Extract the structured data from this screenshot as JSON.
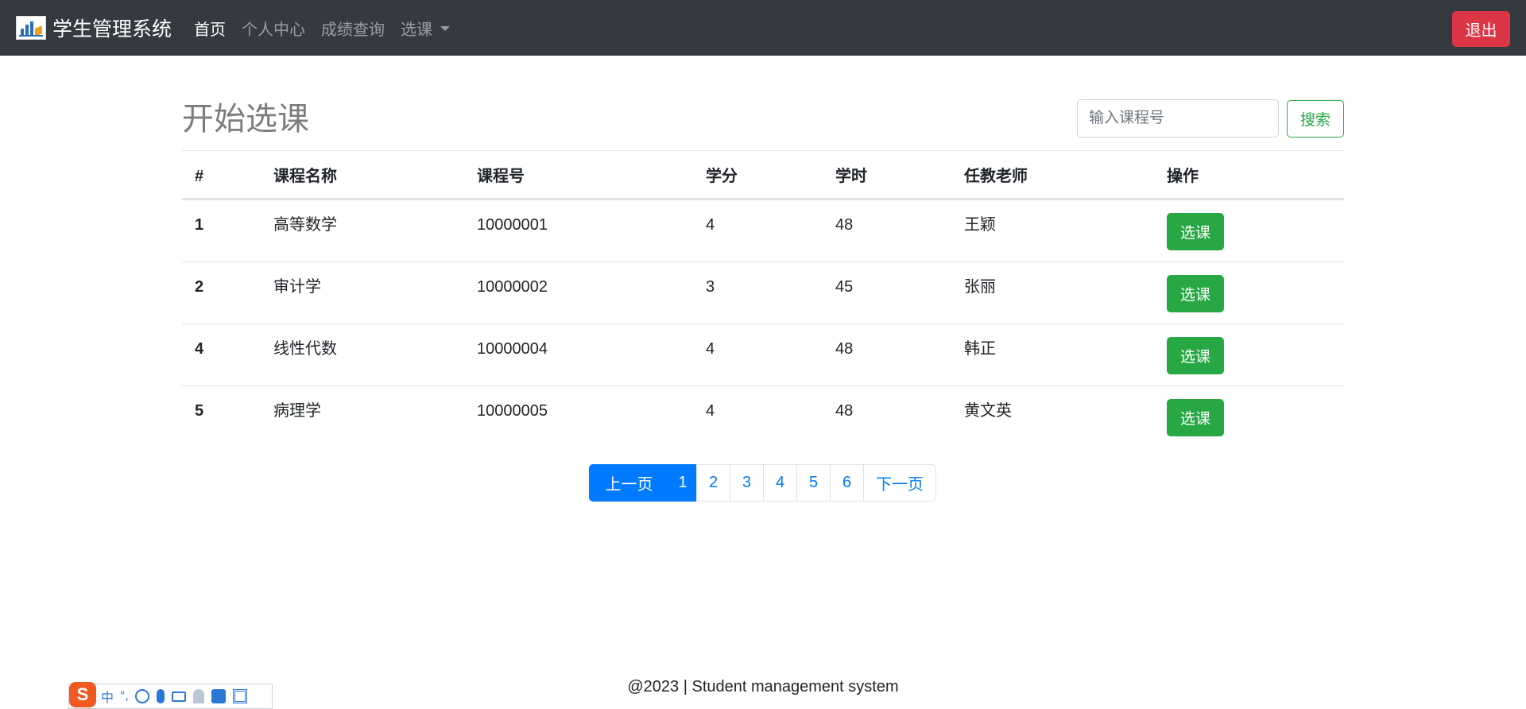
{
  "navbar": {
    "brand": "学生管理系统",
    "links": [
      "首页",
      "个人中心",
      "成绩查询"
    ],
    "dropdown": "选课",
    "logout": "退出"
  },
  "main": {
    "title": "开始选课",
    "search_placeholder": "输入课程号",
    "search_button": "搜索"
  },
  "table": {
    "headers": [
      "#",
      "课程名称",
      "课程号",
      "学分",
      "学时",
      "任教老师",
      "操作"
    ],
    "rows": [
      {
        "id": "1",
        "name": "高等数学",
        "code": "10000001",
        "credit": "4",
        "hours": "48",
        "teacher": "王颖",
        "action": "选课"
      },
      {
        "id": "2",
        "name": "审计学",
        "code": "10000002",
        "credit": "3",
        "hours": "45",
        "teacher": "张丽",
        "action": "选课"
      },
      {
        "id": "4",
        "name": "线性代数",
        "code": "10000004",
        "credit": "4",
        "hours": "48",
        "teacher": "韩正",
        "action": "选课"
      },
      {
        "id": "5",
        "name": "病理学",
        "code": "10000005",
        "credit": "4",
        "hours": "48",
        "teacher": "黄文英",
        "action": "选课"
      }
    ]
  },
  "pagination": {
    "prev": "上一页",
    "pages": [
      "1",
      "2",
      "3",
      "4",
      "5",
      "6"
    ],
    "current": "1",
    "next": "下一页"
  },
  "footer": {
    "text": "@2023 | Student management system"
  },
  "ime": {
    "logo": "S",
    "mode": "中",
    "punct": "°,"
  },
  "colors": {
    "navbar_bg": "#343a40",
    "danger": "#dc3545",
    "success": "#28a745",
    "primary": "#007bff"
  }
}
